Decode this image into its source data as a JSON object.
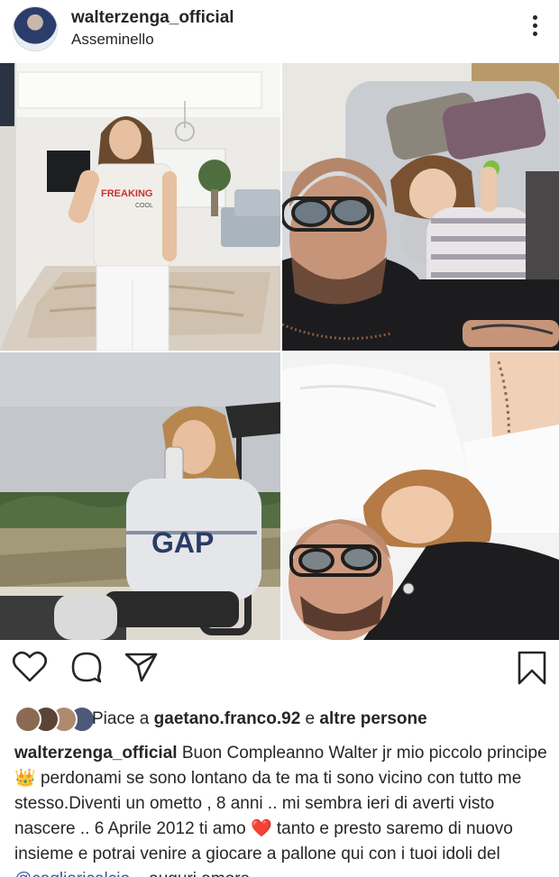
{
  "post": {
    "username": "walterzenga_official",
    "location": "Asseminello"
  },
  "likes": {
    "prefix": "Piace a ",
    "user": "gaetano.franco.92",
    "middle": " e ",
    "others": "altre persone"
  },
  "caption": {
    "user": "walterzenga_official",
    "text1": " Buon Compleanno Walter jr mio piccolo principe ",
    "emoji_crown": "👑",
    "text2": " perdonami se sono lontano da te ma ti sono vicino con tutto me stesso.Diventi un ometto , 8 anni .. mi sembra ieri di averti visto nascere .. 6 Aprile 2012 ti amo ",
    "emoji_heart": "❤️",
    "text3": " tanto e presto saremo di nuovo insieme e potrai venire a giocare a pallone qui con i tuoi idoli del ",
    "mention": "@cagliaricalcio",
    "text4": " .. auguri amore"
  },
  "photos": {
    "shirt_text": "FREAKING",
    "shirt_sub": "COOL"
  },
  "icons": {
    "like": "heart-outline-icon",
    "comment": "comment-bubble-icon",
    "share": "paper-plane-icon",
    "save": "bookmark-icon",
    "more": "more-vertical-icon"
  }
}
